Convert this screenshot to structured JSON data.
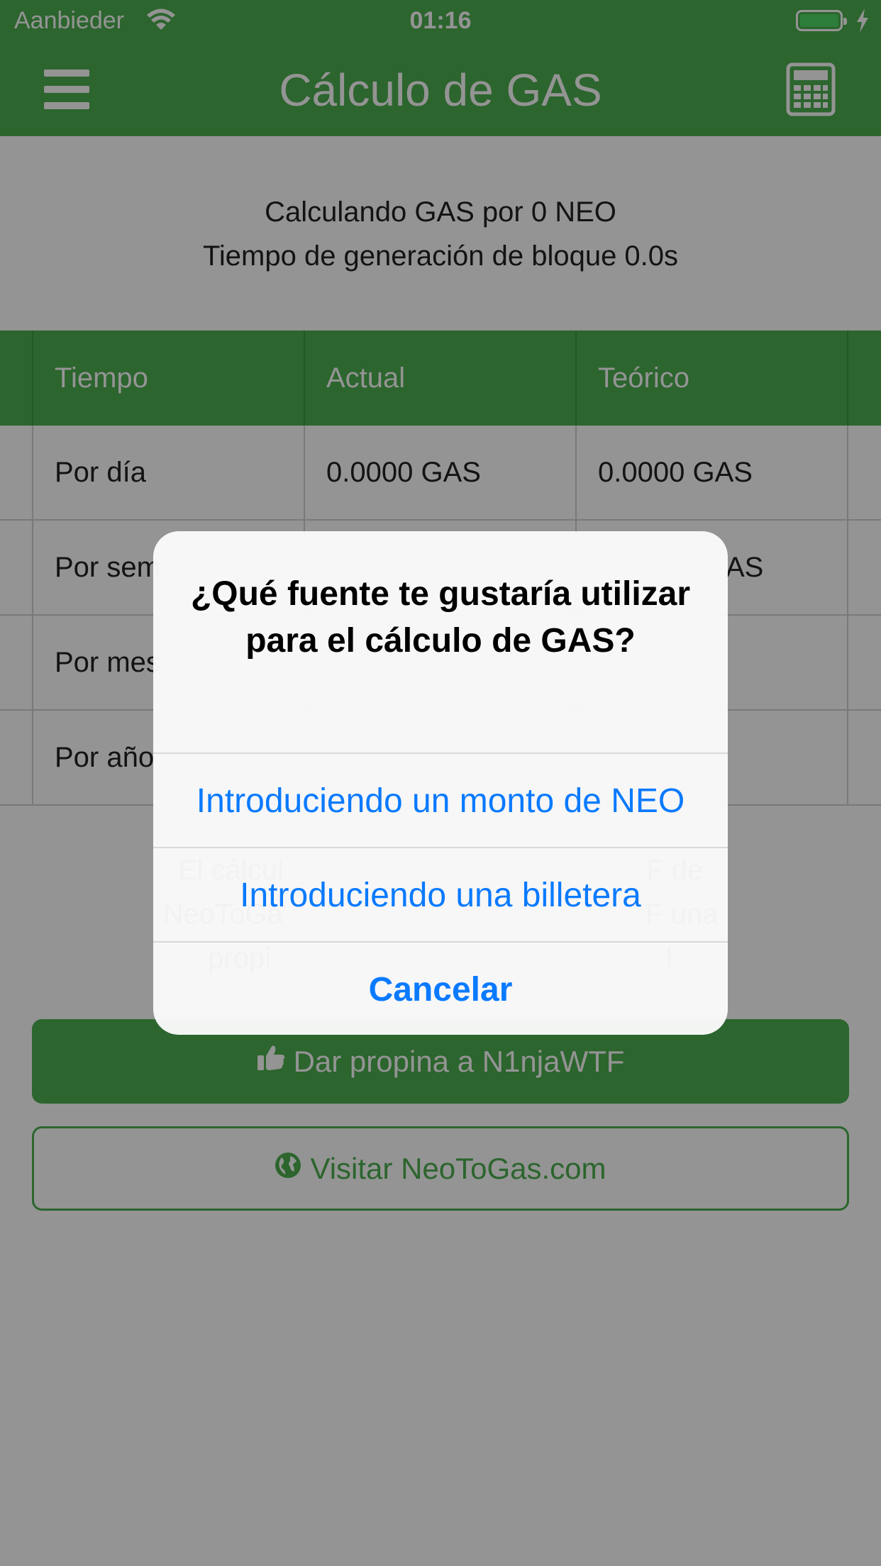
{
  "status_bar": {
    "carrier": "Aanbieder",
    "time": "01:16"
  },
  "nav": {
    "title": "Cálculo de GAS"
  },
  "info": {
    "line1": "Calculando GAS por 0 NEO",
    "line2": "Tiempo de generación de bloque 0.0s"
  },
  "table": {
    "headers": [
      "Tiempo",
      "Actual",
      "Teórico"
    ],
    "rows": [
      [
        "Por día",
        "0.0000 GAS",
        "0.0000 GAS"
      ],
      [
        "Por sem",
        "",
        "AS"
      ],
      [
        "Por mes",
        "",
        ""
      ],
      [
        "Por año",
        "",
        ""
      ]
    ]
  },
  "note": {
    "line1": "El cálcul                                              F de",
    "line2": "NeoToGa                                              F una",
    "line3": "propi                                                  !"
  },
  "buttons": {
    "tip": "Dar propina a N1njaWTF",
    "visit": "Visitar NeoToGas.com"
  },
  "alert": {
    "title": "¿Qué fuente te gustaría utilizar para el cálculo de GAS?",
    "options": [
      "Introduciendo un monto de NEO",
      "Introduciendo una billetera"
    ],
    "cancel": "Cancelar"
  },
  "colors": {
    "brand_green": "#4caf50",
    "ios_blue": "#0a7aff"
  },
  "icons": [
    "wifi-icon",
    "battery-icon",
    "charging-icon",
    "menu-icon",
    "calculator-icon",
    "thumbs-up-icon",
    "globe-icon"
  ]
}
